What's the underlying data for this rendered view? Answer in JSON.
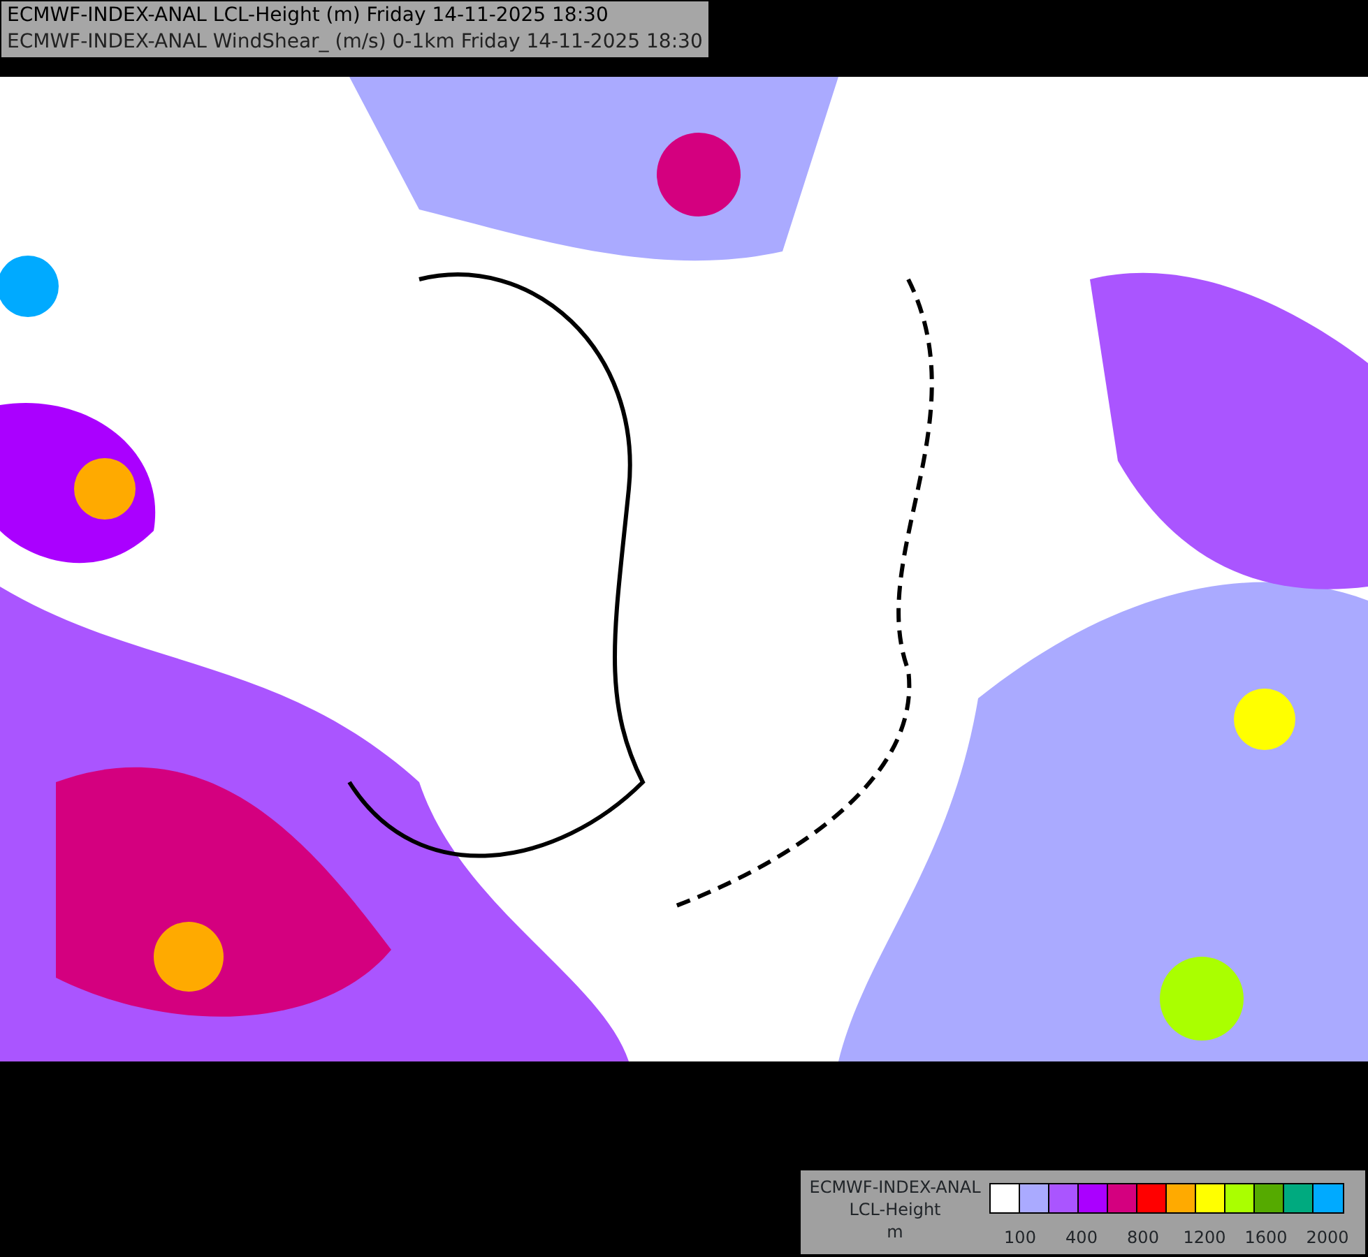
{
  "titles": [
    "ECMWF-INDEX-ANAL LCL-Height (m) Friday 14-11-2025 18:30",
    "ECMWF-INDEX-ANAL WindShear_ (m/s) 0-1km Friday 14-11-2025 18:30"
  ],
  "legend": {
    "title_lines": [
      "ECMWF-INDEX-ANAL",
      "LCL-Height",
      "m"
    ],
    "swatches": [
      {
        "color": "#ffffff"
      },
      {
        "color": "#aaaaff"
      },
      {
        "color": "#aa55ff"
      },
      {
        "color": "#aa00ff"
      },
      {
        "color": "#d4007f"
      },
      {
        "color": "#ff0000"
      },
      {
        "color": "#ffaa00"
      },
      {
        "color": "#ffff00"
      },
      {
        "color": "#aaff00"
      },
      {
        "color": "#55aa00"
      },
      {
        "color": "#00aa7f"
      },
      {
        "color": "#00aaff"
      }
    ],
    "tick_labels": [
      "100",
      "400",
      "800",
      "1200",
      "1600",
      "2000"
    ]
  }
}
